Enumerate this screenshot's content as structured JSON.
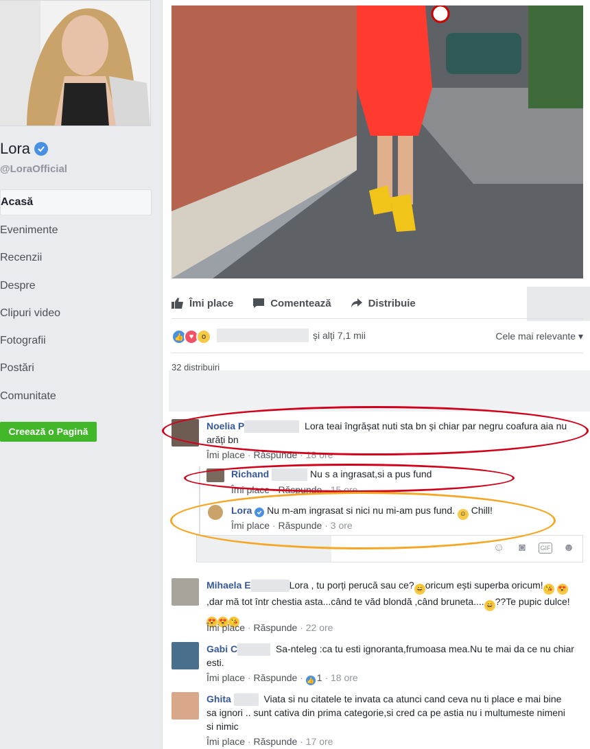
{
  "page": {
    "name": "Lora",
    "handle": "@LoraOfficial",
    "nav": [
      "Acasă",
      "Evenimente",
      "Recenzii",
      "Despre",
      "Clipuri video",
      "Fotografii",
      "Postări",
      "Comunitate"
    ],
    "create_page": "Creează o Pagină"
  },
  "post": {
    "actions": {
      "like": "Îmi place",
      "comment": "Comentează",
      "share": "Distribuie"
    },
    "reactions_others": "și alți 7,1 mii",
    "sort": "Cele mai relevante",
    "shares": "32 distribuiri"
  },
  "comments": [
    {
      "name": "Noelia P",
      "text": "Lora teai îngrășat nuti sta bn și chiar par negru coafura aia nu arăți bn",
      "like": "Îmi place",
      "reply": "Răspunde",
      "time": "18 ore"
    },
    {
      "name": "Richand",
      "text": "Nu s a ingrasat,si a pus fund",
      "like": "Îmi place",
      "reply": "Răspunde",
      "time": "15 ore"
    },
    {
      "name": "Lora",
      "text": "Nu m-am ingrasat si nici nu mi-am pus fund.",
      "text2": "Chill!",
      "like": "Îmi place",
      "reply": "Răspunde",
      "time": "3 ore"
    },
    {
      "name": "Mihaela E",
      "text1": "Lora , tu porți perucă sau ce?",
      "text2": "oricum ești superba oricum!",
      "text3": ",dar mă tot într chestia asta...când te văd blondă ,când bruneta....",
      "text4": "??Te pupic dulce!",
      "like": "Îmi place",
      "reply": "Răspunde",
      "time": "22 ore"
    },
    {
      "name": "Gabi C",
      "text": "Sa-nteleg :ca tu esti ignoranta,frumoasa mea.Nu te mai da ce nu chiar esti.",
      "like": "Îmi place",
      "reply": "Răspunde",
      "likes": "1",
      "time": "18 ore"
    },
    {
      "name": "Ghita",
      "text": "Viata si nu citatele te invata ca atunci cand ceva nu ti place e mai bine sa ignori .. sunt cativa din prima categorie,si cred ca pe astia nu i multumeste nimeni si nimic",
      "like": "Îmi place",
      "reply": "Răspunde",
      "time": "17 ore"
    }
  ],
  "sep": "·",
  "colors": {
    "link": "#365899",
    "verified": "#4a90e2",
    "green": "#42b72a",
    "red_mark": "#d0021b",
    "orange_mark": "#f5a623"
  }
}
